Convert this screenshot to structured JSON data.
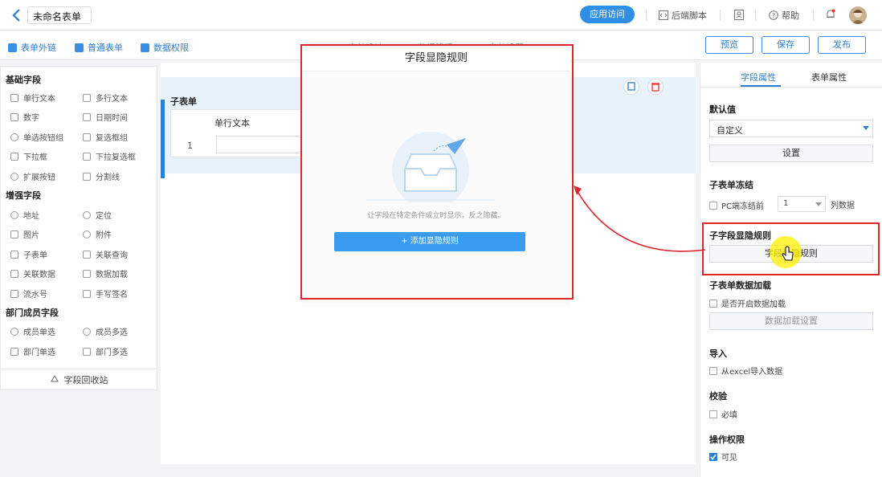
{
  "topbar": {
    "form_title": "未命名表单",
    "app_visit": "应用访问",
    "backend_script": "后端脚本",
    "help": "帮助"
  },
  "toolbar2": {
    "links": [
      "表单外链",
      "普通表单",
      "数据权限"
    ],
    "tabs": [
      "表单设计",
      "数据管理",
      "表单设置"
    ],
    "preview": "预览",
    "save": "保存",
    "publish": "发布"
  },
  "left": {
    "basic_title": "基础字段",
    "basic": [
      "单行文本",
      "多行文本",
      "数字",
      "日期时间",
      "单选按钮组",
      "复选框组",
      "下拉框",
      "下拉复选框",
      "扩展按钮",
      "分割线"
    ],
    "enhanced_title": "增强字段",
    "enhanced": [
      "地址",
      "定位",
      "图片",
      "附件",
      "子表单",
      "关联查询",
      "关联数据",
      "数据加载",
      "流水号",
      "手写签名"
    ],
    "dept_title": "部门成员字段",
    "dept": [
      "成员单选",
      "成员多选",
      "部门单选",
      "部门多选"
    ],
    "recycle": "字段回收站"
  },
  "canvas": {
    "subform_title": "子表单",
    "column_header": "单行文本",
    "row_number": "1"
  },
  "modal": {
    "title": "字段显隐规则",
    "hint": "让字段在特定条件成立时显示，反之隐藏。",
    "add_rule": "+ 添加显隐规则"
  },
  "right": {
    "tab_field": "字段属性",
    "tab_form": "表单属性",
    "default_label": "默认值",
    "default_value": "自定义",
    "settings_btn": "设置",
    "freeze_label": "子表单冻结",
    "freeze_chk": "PC端冻结前",
    "freeze_value": "1",
    "freeze_suffix": "列数据",
    "vis_rule_label": "子字段显隐规则",
    "vis_rule_btn": "字段显隐规则",
    "load_label": "子表单数据加载",
    "load_chk": "是否开启数据加载",
    "load_btn": "数据加载设置",
    "import_label": "导入",
    "import_chk": "从excel导入数据",
    "validate_label": "校验",
    "required_chk": "必填",
    "perm_label": "操作权限",
    "visible_chk": "可见"
  },
  "colors": {
    "accent": "#2f7fd0",
    "primary_btn": "#3a9cf0",
    "highlight_red": "#d9272e"
  }
}
